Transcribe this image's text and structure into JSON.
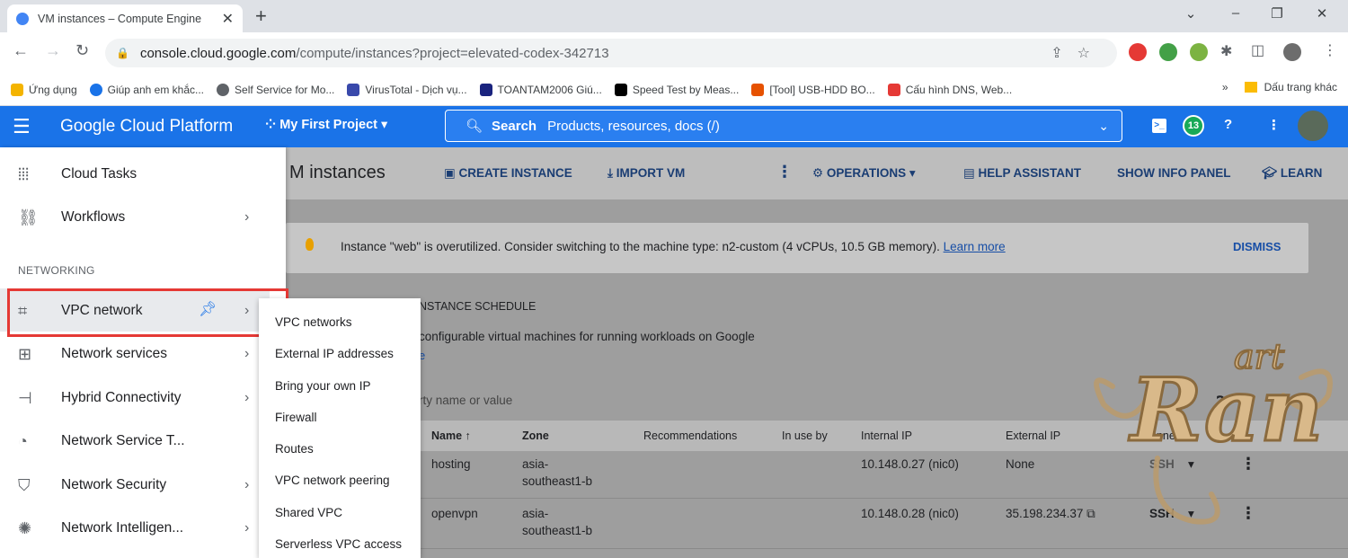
{
  "browser": {
    "tab_title": "VM instances – Compute Engine",
    "url_host": "console.cloud.google.com",
    "url_path": "/compute/instances?project=elevated-codex-342713",
    "bookmarks": [
      {
        "label": "Ứng dụng",
        "color": "#f4b400"
      },
      {
        "label": "Giúp anh em khắc...",
        "color": "#1a73e8"
      },
      {
        "label": "Self Service for Mo...",
        "color": "#5f6368"
      },
      {
        "label": "VirusTotal - Dịch vụ...",
        "color": "#3949ab"
      },
      {
        "label": "TOANTAM2006 Giú...",
        "color": "#1a237e"
      },
      {
        "label": "Speed Test by Meas...",
        "color": "#000000"
      },
      {
        "label": "[Tool] USB-HDD BO...",
        "color": "#e65100"
      },
      {
        "label": "Cấu hình DNS, Web...",
        "color": "#e53935"
      }
    ],
    "bookmarks_more": "»",
    "bookmarks_folder": "Dấu trang khác"
  },
  "gcp": {
    "brand": "Google Cloud Platform",
    "project": "My First Project",
    "search_label": "Search",
    "search_placeholder": "Products, resources, docs (/)",
    "notifications": "13"
  },
  "page": {
    "title": "M instances",
    "actions": {
      "create": "CREATE INSTANCE",
      "import": "IMPORT VM",
      "operations": "OPERATIONS",
      "help": "HELP ASSISTANT",
      "info": "SHOW INFO PANEL",
      "learn": "LEARN"
    },
    "alert": {
      "text": "Instance \"web\" is overutilized. Consider switching to the machine type: n2-custom (4 vCPUs, 10.5 GB memory).",
      "link": "Learn more",
      "dismiss": "DISMISS"
    },
    "schedule_tab": "NSTANCE SCHEDULE",
    "description": "configurable virtual machines for running workloads on Google",
    "filter_placeholder": "rty name or value",
    "columns": [
      "Name",
      "Zone",
      "Recommendations",
      "In use by",
      "Internal IP",
      "External IP",
      "Connect"
    ],
    "rows": [
      {
        "name": "hosting",
        "zone1": "asia-",
        "zone2": "southeast1-b",
        "internal": "10.148.0.27 (nic0)",
        "external": "None",
        "connect": "SSH"
      },
      {
        "name": "openvpn",
        "zone1": "asia-",
        "zone2": "southeast1-b",
        "internal": "10.148.0.28 (nic0)",
        "external": "35.198.234.37",
        "connect": "SSH"
      }
    ]
  },
  "nav": {
    "items_top": [
      {
        "label": "Cloud Tasks",
        "icon": "tasks-icon"
      },
      {
        "label": "Workflows",
        "icon": "workflows-icon"
      }
    ],
    "section_label": "NETWORKING",
    "items_net": [
      {
        "label": "VPC network",
        "icon": "vpc-icon"
      },
      {
        "label": "Network services",
        "icon": "network-services-icon"
      },
      {
        "label": "Hybrid Connectivity",
        "icon": "hybrid-icon"
      },
      {
        "label": "Network Service T...",
        "icon": "network-tier-icon"
      },
      {
        "label": "Network Security",
        "icon": "shield-icon"
      },
      {
        "label": "Network Intelligen...",
        "icon": "intelligence-icon"
      }
    ]
  },
  "submenu": [
    "VPC networks",
    "External IP addresses",
    "Bring your own IP",
    "Firewall",
    "Routes",
    "VPC network peering",
    "Shared VPC",
    "Serverless VPC access"
  ],
  "watermark": {
    "top": "art",
    "main": "Ran"
  }
}
